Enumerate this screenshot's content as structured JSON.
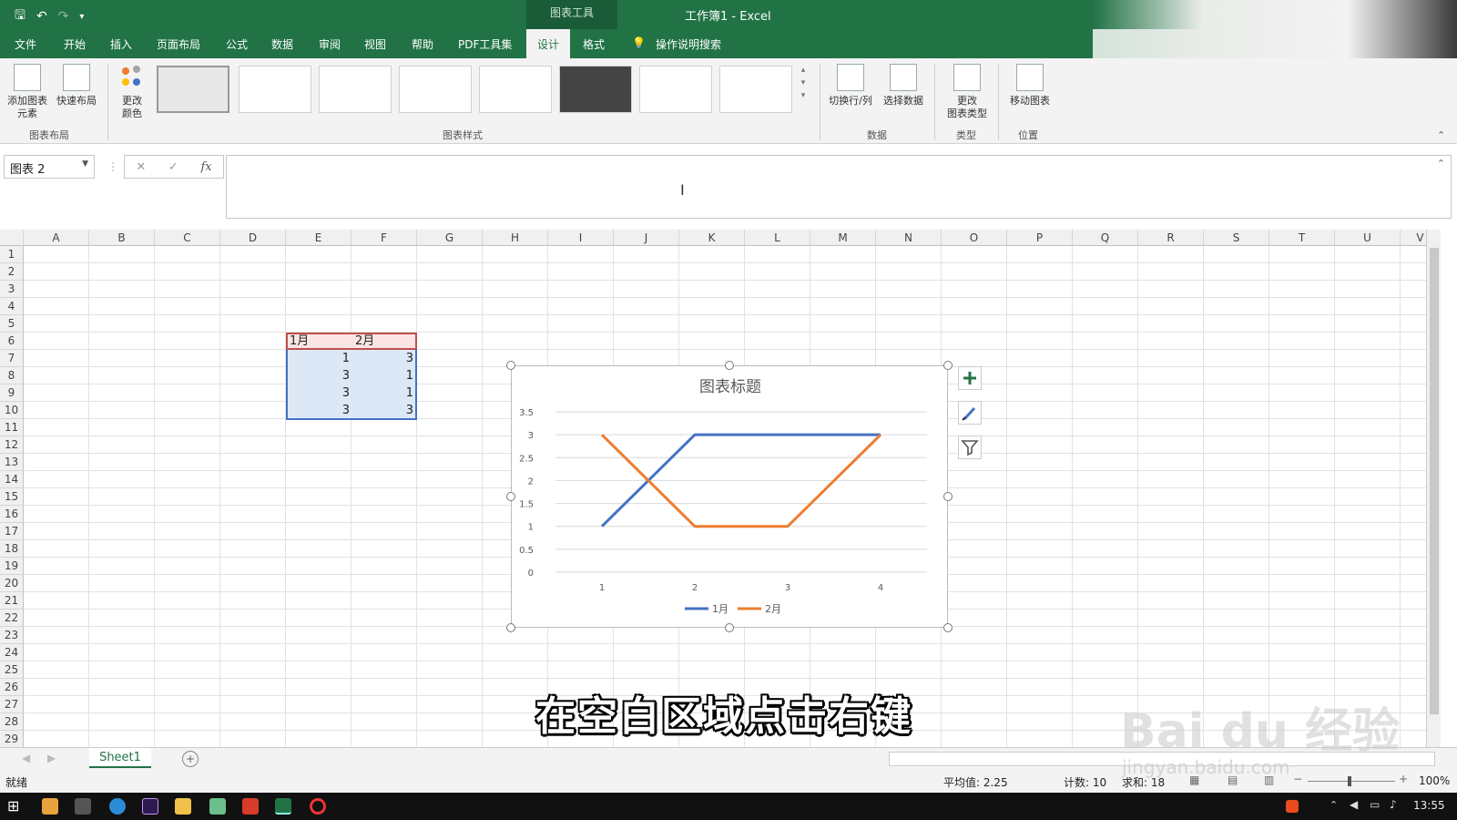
{
  "window": {
    "title": "工作簿1  -  Excel",
    "context_tool": "图表工具"
  },
  "tabs": [
    "文件",
    "开始",
    "插入",
    "页面布局",
    "公式",
    "数据",
    "审阅",
    "视图",
    "帮助",
    "PDF工具集",
    "设计",
    "格式"
  ],
  "active_tab": "设计",
  "search": {
    "label": "操作说明搜索"
  },
  "ribbon": {
    "add_element": "添加图表\n元素",
    "quick_layout": "快速布局",
    "change_color": "更改\n颜色",
    "group_layout": "图表布局",
    "group_styles": "图表样式",
    "switch_row_col": "切换行/列",
    "select_data": "选择数据",
    "group_data": "数据",
    "change_type": "更改\n图表类型",
    "group_type": "类型",
    "move_chart": "移动图表",
    "group_position": "位置"
  },
  "namebox": {
    "value": "图表 2"
  },
  "columns": [
    "A",
    "B",
    "C",
    "D",
    "E",
    "F",
    "G",
    "H",
    "I",
    "J",
    "K",
    "L",
    "M",
    "N",
    "O",
    "P",
    "Q",
    "R",
    "S",
    "T",
    "U",
    "V"
  ],
  "rows": [
    "1",
    "2",
    "3",
    "4",
    "5",
    "6",
    "7",
    "8",
    "9",
    "10",
    "11",
    "12",
    "13",
    "14",
    "15",
    "16",
    "17",
    "18",
    "19",
    "20",
    "21",
    "22",
    "23",
    "24",
    "25",
    "26",
    "27",
    "28",
    "29"
  ],
  "table": {
    "headers": [
      "1月",
      "2月"
    ],
    "values": [
      [
        "1",
        "3"
      ],
      [
        "3",
        "1"
      ],
      [
        "3",
        "1"
      ],
      [
        "3",
        "3"
      ]
    ]
  },
  "chart_data": {
    "type": "line",
    "title": "图表标题",
    "categories": [
      "1",
      "2",
      "3",
      "4"
    ],
    "series": [
      {
        "name": "1月",
        "values": [
          1,
          3,
          3,
          3
        ],
        "color": "#4472C4"
      },
      {
        "name": "2月",
        "values": [
          3,
          1,
          1,
          3
        ],
        "color": "#ED7D31"
      }
    ],
    "yticks": [
      "0",
      "0.5",
      "1",
      "1.5",
      "2",
      "2.5",
      "3",
      "3.5"
    ],
    "ylim": [
      0,
      3.5
    ],
    "grid": true,
    "legend": "bottom"
  },
  "sheet_tab": "Sheet1",
  "status": {
    "mode": "就绪",
    "average": "平均值: 2.25",
    "count": "计数: 10",
    "sum": "求和: 18",
    "zoom": "100%"
  },
  "taskbar": {
    "time": "13:55"
  },
  "subtitle": "在空白区域点击右键",
  "watermark": {
    "brand": "Bai du 经验",
    "url": "jingyan.baidu.com"
  }
}
